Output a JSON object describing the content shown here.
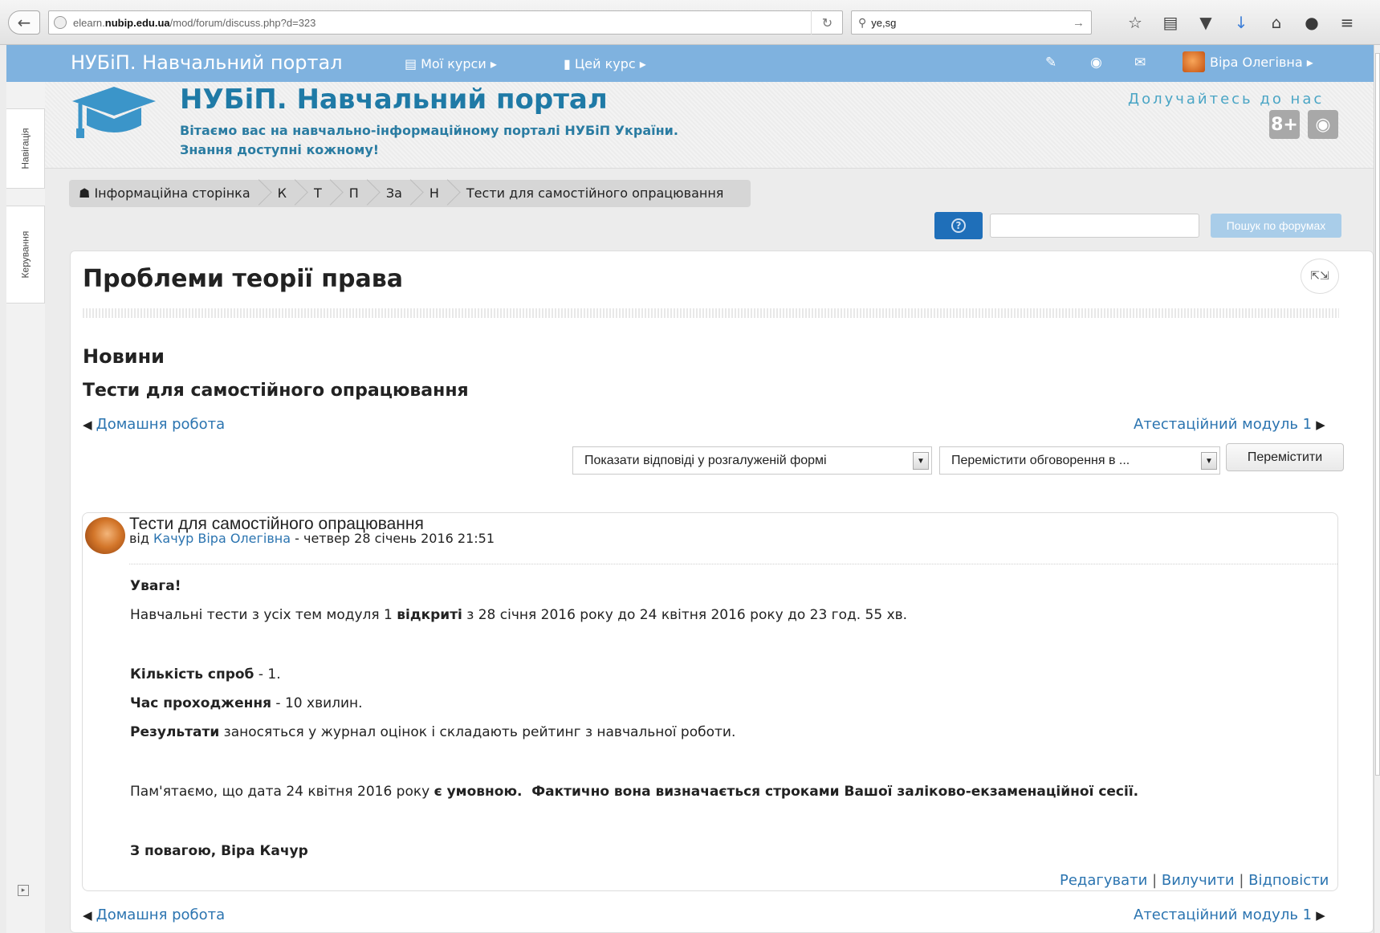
{
  "browser": {
    "url_prefix": "elearn.",
    "url_host": "nubip.edu.ua",
    "url_path": "/mod/forum/discuss.php?d=323",
    "search_value": "ye,sg"
  },
  "navbar": {
    "brand": "НУБіП. Навчальний портал",
    "my_courses": "Мої курси",
    "this_course": "Цей курс",
    "user_name": "Віра Олегівна"
  },
  "dock": {
    "navigation": "Навігація",
    "administration": "Керування"
  },
  "header": {
    "title": "НУБіП. Навчальний портал",
    "subtitle_line1": "Вітаємо вас на навчально-інформаційному порталі НУБіП України.",
    "subtitle_line2": "Знання доступні кожному!",
    "join_us": "Долучайтесь до нас",
    "gplus": "8+"
  },
  "breadcrumb": [
    "Інформаційна сторінка",
    "К",
    "Т",
    "П",
    "За",
    "Н",
    "Тести для самостійного опрацювання"
  ],
  "search": {
    "input_value": "",
    "button_label": "Пошук по форумах"
  },
  "main": {
    "course_title": "Проблеми теорії права",
    "forum_name": "Новини",
    "discussion_title": "Тести для самостійного опрацювання",
    "prev_link": "Домашня робота",
    "next_link": "Атестаційний модуль 1",
    "display_mode": "Показати відповіді у розгалуженій формі",
    "move_to": "Перемістити обговорення в ...",
    "move_button": "Перемістити"
  },
  "post": {
    "subject": "Тести для самостійного опрацювання",
    "by_label": "від",
    "author": "Качур Віра Олегівна",
    "date": "четвер 28 січень 2016 21:51",
    "attention": "Увага!",
    "line1_pre": "Навчальні тести з усіх тем модуля 1",
    "line1_bold": "відкриті",
    "line1_post": "з 28 січня 2016 року до 24 квітня 2016 року до 23 год. 55 хв.",
    "attempts_label": "Кількість спроб",
    "attempts_value": " - 1.",
    "time_label": "Час проходження",
    "time_value": " - 10 хвилин.",
    "results_label": "Результати",
    "results_value": " заносяться у журнал оцінок і складають рейтинг з навчальної роботи.",
    "note_pre": "Пам'ятаємо, що дата 24 квітня 2016 року ",
    "note_bold1": "є умовною.",
    "note_bold2": "  Фактично вона визначається строками Вашої заліково-екзаменаційної сесії.",
    "signature": "З повагою, Віра Качур",
    "edit": "Редагувати",
    "delete": "Вилучити",
    "reply": "Відповісти"
  }
}
